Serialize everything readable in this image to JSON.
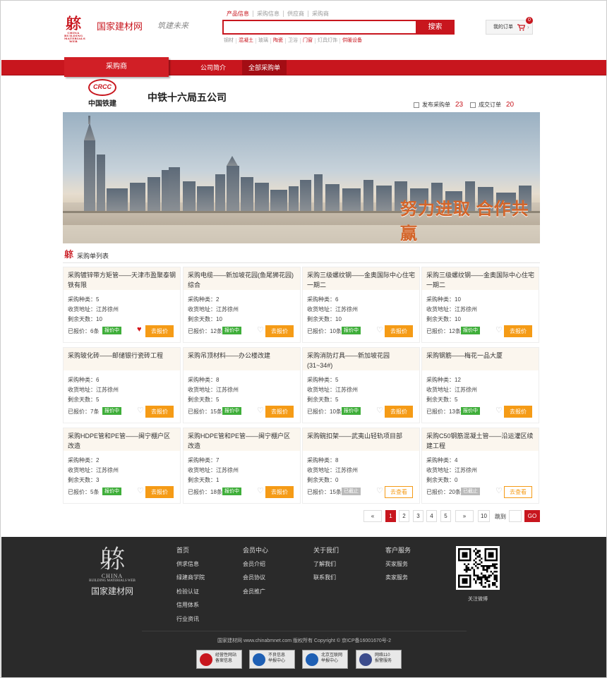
{
  "header": {
    "logo_text": "国家建材网",
    "logo_mark": "𨈼",
    "logo_mark_sub": "CHINA BUILDING MATERIALS WEB",
    "slogan": "筑建未来",
    "search_tabs": [
      "产品信息",
      "采购信息",
      "供应商",
      "采购商"
    ],
    "search_button": "搜索",
    "hot_words": [
      "钢材",
      "混凝土",
      "玻璃",
      "陶瓷",
      "卫浴",
      "门窗",
      "灯具灯饰",
      "供暖设备"
    ],
    "order_label": "我的订单",
    "order_count": "0"
  },
  "nav": {
    "main_tab": "采购商",
    "links": [
      "公司简介",
      "全部采购单"
    ]
  },
  "company": {
    "logo_abbr": "CRCC",
    "logo_cn": "中国铁建",
    "name": "中铁十六局五公司",
    "published_label": "发布采购单",
    "published_count": "23",
    "deals_label": "成交订单",
    "deals_count": "20"
  },
  "banner": {
    "slogan": "努力进取 合作共赢"
  },
  "list": {
    "title": "采购单列表",
    "labels": {
      "kinds": "采购种类：",
      "address": "收货地址：",
      "days": "剩余天数：",
      "quoted": "已报价："
    },
    "cards": [
      {
        "title": "采购镀锌带方矩管——天津市盈聚泰钢铁有限",
        "kinds": "5",
        "address": "江苏徐州",
        "days": "10",
        "quoted": "6条",
        "status": "报价中",
        "liked": true,
        "action": "去报价"
      },
      {
        "title": "采购电缆——新加坡花园(鱼尾狮花园)综合",
        "kinds": "2",
        "address": "江苏徐州",
        "days": "10",
        "quoted": "12条",
        "status": "报价中",
        "liked": false,
        "action": "去报价"
      },
      {
        "title": "采购三级螺纹钢——金奥国际中心住宅一期二",
        "kinds": "6",
        "address": "江苏徐州",
        "days": "10",
        "quoted": "10条",
        "status": "报价中",
        "liked": false,
        "action": "去报价"
      },
      {
        "title": "采购三级螺纹钢——金奥国际中心住宅一期二",
        "kinds": "10",
        "address": "江苏徐州",
        "days": "10",
        "quoted": "12条",
        "status": "报价中",
        "liked": false,
        "action": "去报价"
      },
      {
        "title": "采购玻化砖——邮储银行瓷砖工程",
        "kinds": "6",
        "address": "江苏徐州",
        "days": "5",
        "quoted": "7条",
        "status": "报价中",
        "liked": false,
        "action": "去报价"
      },
      {
        "title": "采购吊顶材料——办公楼改建",
        "kinds": "8",
        "address": "江苏徐州",
        "days": "5",
        "quoted": "15条",
        "status": "报价中",
        "liked": false,
        "action": "去报价"
      },
      {
        "title": "采购消防灯具——新加坡花园(31~34#)",
        "kinds": "5",
        "address": "江苏徐州",
        "days": "5",
        "quoted": "10条",
        "status": "报价中",
        "liked": false,
        "action": "去报价"
      },
      {
        "title": "采购钢筋——梅花一品大厦",
        "kinds": "12",
        "address": "江苏徐州",
        "days": "5",
        "quoted": "13条",
        "status": "报价中",
        "liked": false,
        "action": "去报价"
      },
      {
        "title": "采购HDPE管和PE管——闽宁棚户区改造",
        "kinds": "2",
        "address": "江苏徐州",
        "days": "3",
        "quoted": "5条",
        "status": "报价中",
        "liked": false,
        "action": "去报价"
      },
      {
        "title": "采购HDPE管和PE管——闽宁棚户区改造",
        "kinds": "7",
        "address": "江苏徐州",
        "days": "1",
        "quoted": "18条",
        "status": "报价中",
        "liked": false,
        "action": "去报价"
      },
      {
        "title": "采购碗扣架——武夷山轻轨项目部",
        "kinds": "8",
        "address": "江苏徐州",
        "days": "0",
        "quoted": "15条",
        "status": "已截止",
        "liked": false,
        "action": "去查看"
      },
      {
        "title": "采购C50钢筋混凝土管——沿运灌区续建工程",
        "kinds": "4",
        "address": "江苏徐州",
        "days": "0",
        "quoted": "20条",
        "status": "已截止",
        "liked": false,
        "action": "去查看"
      }
    ]
  },
  "pagination": {
    "prev": "«",
    "next": "»",
    "pages": [
      "1",
      "2",
      "3",
      "4",
      "5"
    ],
    "current": "1",
    "last": "10",
    "jump_label": "跳到",
    "go": "GO"
  },
  "footer": {
    "logo_en1": "CHINA",
    "logo_en2": "BUILDING MATERIALS WEB",
    "logo_cn": "国家建材网",
    "columns": [
      [
        "首页",
        "供求信息",
        "绿建商学院",
        "检验认证",
        "信用体系",
        "行业资讯"
      ],
      [
        "会员中心",
        "会员介绍",
        "会员协议",
        "会员推广"
      ],
      [
        "关于我们",
        "了解我们",
        "联系我们"
      ],
      [
        "客户服务",
        "买家服务",
        "卖家服务"
      ]
    ],
    "qr_label": "关注微博",
    "copyright": "国家建材网 www.chinabmnet.com 版权所有  Copyright © 京ICP备16001670号-2",
    "certs": [
      {
        "l1": "经营性网站",
        "l2": "备案信息",
        "color": "#c8161e"
      },
      {
        "l1": "不良信息",
        "l2": "举报中心",
        "color": "#1e5fb4"
      },
      {
        "l1": "北京互联网",
        "l2": "举报中心",
        "color": "#1e5fb4"
      },
      {
        "l1": "网络110",
        "l2": "报警服务",
        "color": "#3c4c8c"
      }
    ]
  },
  "colors": {
    "brand_red": "#c8161e",
    "orange": "#f59b16",
    "green_status": "#3fae3a"
  }
}
